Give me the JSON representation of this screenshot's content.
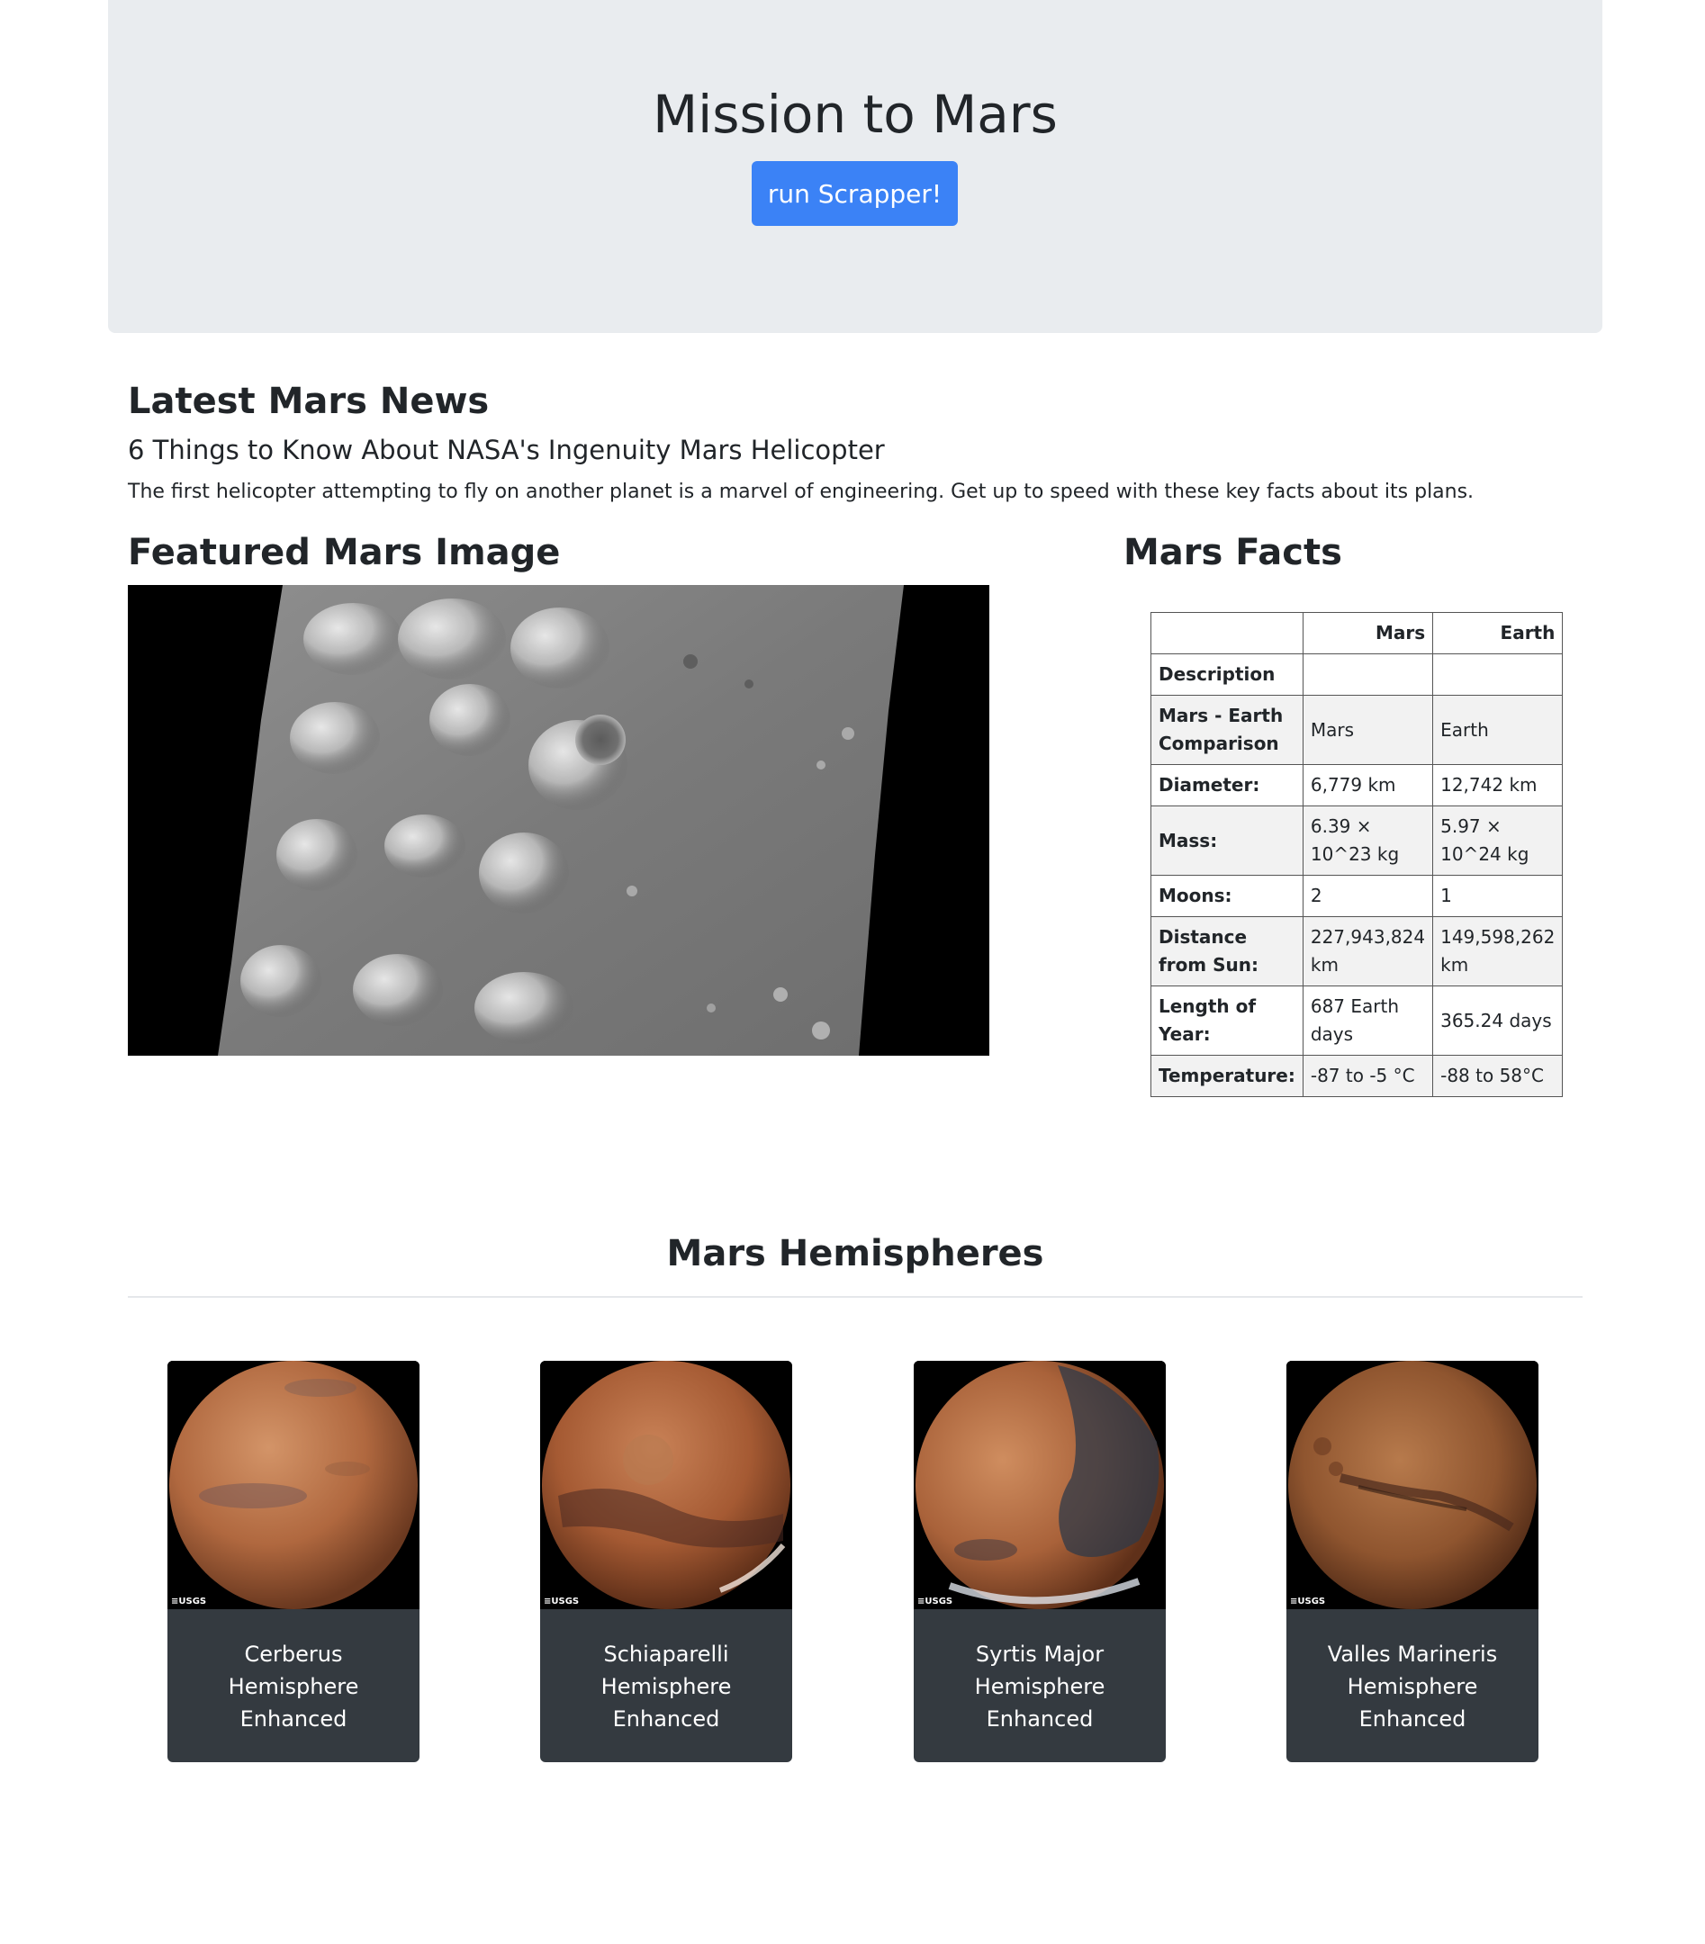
{
  "header": {
    "title": "Mission to Mars",
    "button_label": "run Scrapper!"
  },
  "news": {
    "section_title": "Latest Mars News",
    "headline": "6 Things to Know About NASA's Ingenuity Mars Helicopter",
    "paragraph": "The first helicopter attempting to fly on another planet is a marvel of engineering. Get up to speed with these key facts about its plans."
  },
  "featured": {
    "section_title": "Featured Mars Image"
  },
  "facts": {
    "section_title": "Mars Facts",
    "columns": [
      "",
      "Mars",
      "Earth"
    ],
    "rows": [
      {
        "label": "Description",
        "mars": "",
        "earth": ""
      },
      {
        "label": "Mars - Earth Comparison",
        "mars": "Mars",
        "earth": "Earth"
      },
      {
        "label": "Diameter:",
        "mars": "6,779 km",
        "earth": "12,742 km"
      },
      {
        "label": "Mass:",
        "mars": "6.39 × 10^23 kg",
        "earth": "5.97 × 10^24 kg"
      },
      {
        "label": "Moons:",
        "mars": "2",
        "earth": "1"
      },
      {
        "label": "Distance from Sun:",
        "mars": "227,943,824 km",
        "earth": "149,598,262 km"
      },
      {
        "label": "Length of Year:",
        "mars": "687 Earth days",
        "earth": "365.24 days"
      },
      {
        "label": "Temperature:",
        "mars": "-87 to -5 °C",
        "earth": "-88 to 58°C"
      }
    ]
  },
  "hemispheres": {
    "section_title": "Mars Hemispheres",
    "items": [
      {
        "title": "Cerberus Hemisphere Enhanced",
        "logo": "≡USGS"
      },
      {
        "title": "Schiaparelli Hemisphere Enhanced",
        "logo": "≡USGS"
      },
      {
        "title": "Syrtis Major Hemisphere Enhanced",
        "logo": "≡USGS"
      },
      {
        "title": "Valles Marineris Hemisphere Enhanced",
        "logo": "≡USGS"
      }
    ]
  },
  "colors": {
    "jumbotron_bg": "#e9ecef",
    "button_bg": "#3b82f6",
    "card_bg": "#343a40"
  }
}
